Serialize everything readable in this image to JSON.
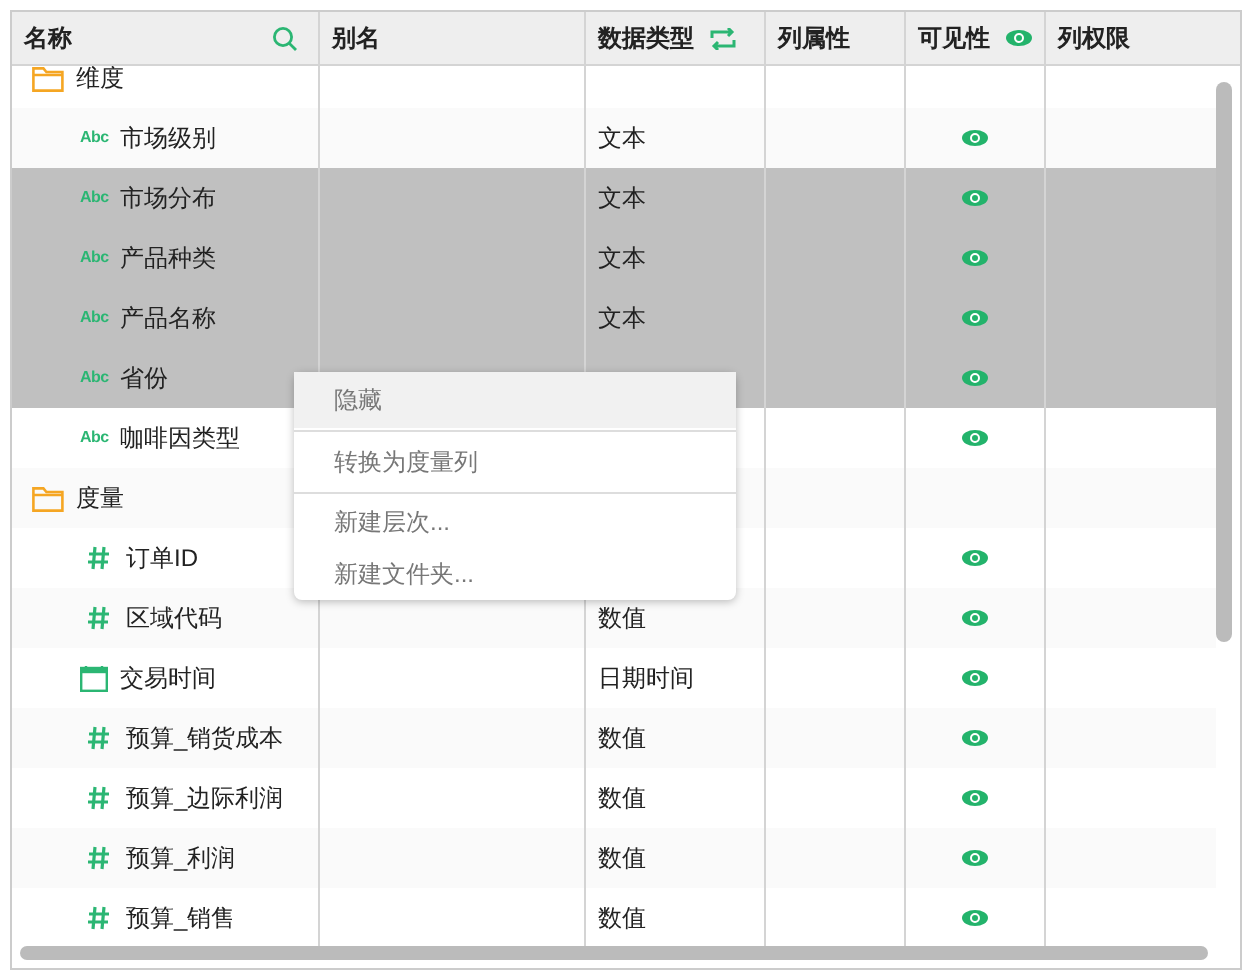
{
  "columns": [
    {
      "label": "名称"
    },
    {
      "label": "别名"
    },
    {
      "label": "数据类型"
    },
    {
      "label": "列属性"
    },
    {
      "label": "可见性"
    },
    {
      "label": "列权限"
    }
  ],
  "rows": [
    {
      "kind": "folder",
      "name": "维度",
      "selected": false
    },
    {
      "kind": "text",
      "badge": "Abc",
      "name": "市场级别",
      "type": "文本",
      "visible": true,
      "selected": false
    },
    {
      "kind": "text",
      "badge": "Abc",
      "name": "市场分布",
      "type": "文本",
      "visible": true,
      "selected": true
    },
    {
      "kind": "text",
      "badge": "Abc",
      "name": "产品种类",
      "type": "文本",
      "visible": true,
      "selected": true
    },
    {
      "kind": "text",
      "badge": "Abc",
      "name": "产品名称",
      "type": "文本",
      "visible": true,
      "selected": true
    },
    {
      "kind": "text",
      "badge": "Abc",
      "name": "省份",
      "visible": true,
      "selected": true
    },
    {
      "kind": "text",
      "badge": "Abc",
      "name": "咖啡因类型",
      "visible": true,
      "selected": false
    },
    {
      "kind": "folder",
      "name": "度量",
      "selected": false
    },
    {
      "kind": "number",
      "name": "订单ID",
      "visible": true,
      "selected": false
    },
    {
      "kind": "number",
      "name": "区域代码",
      "type": "数值",
      "visible": true,
      "selected": false
    },
    {
      "kind": "date",
      "name": "交易时间",
      "type": "日期时间",
      "visible": true,
      "selected": false
    },
    {
      "kind": "number",
      "name": "预算_销货成本",
      "type": "数值",
      "visible": true,
      "selected": false
    },
    {
      "kind": "number",
      "name": "预算_边际利润",
      "type": "数值",
      "visible": true,
      "selected": false
    },
    {
      "kind": "number",
      "name": "预算_利润",
      "type": "数值",
      "visible": true,
      "selected": false
    },
    {
      "kind": "number",
      "name": "预算_销售",
      "type": "数值",
      "visible": true,
      "selected": false
    }
  ],
  "context_menu": [
    {
      "items": [
        {
          "label": "隐藏",
          "highlighted": true
        }
      ]
    },
    {
      "items": [
        {
          "label": "转换为度量列",
          "highlighted": false
        }
      ]
    },
    {
      "items": [
        {
          "label": "新建层次...",
          "highlighted": false
        },
        {
          "label": "新建文件夹...",
          "highlighted": false
        }
      ]
    }
  ]
}
